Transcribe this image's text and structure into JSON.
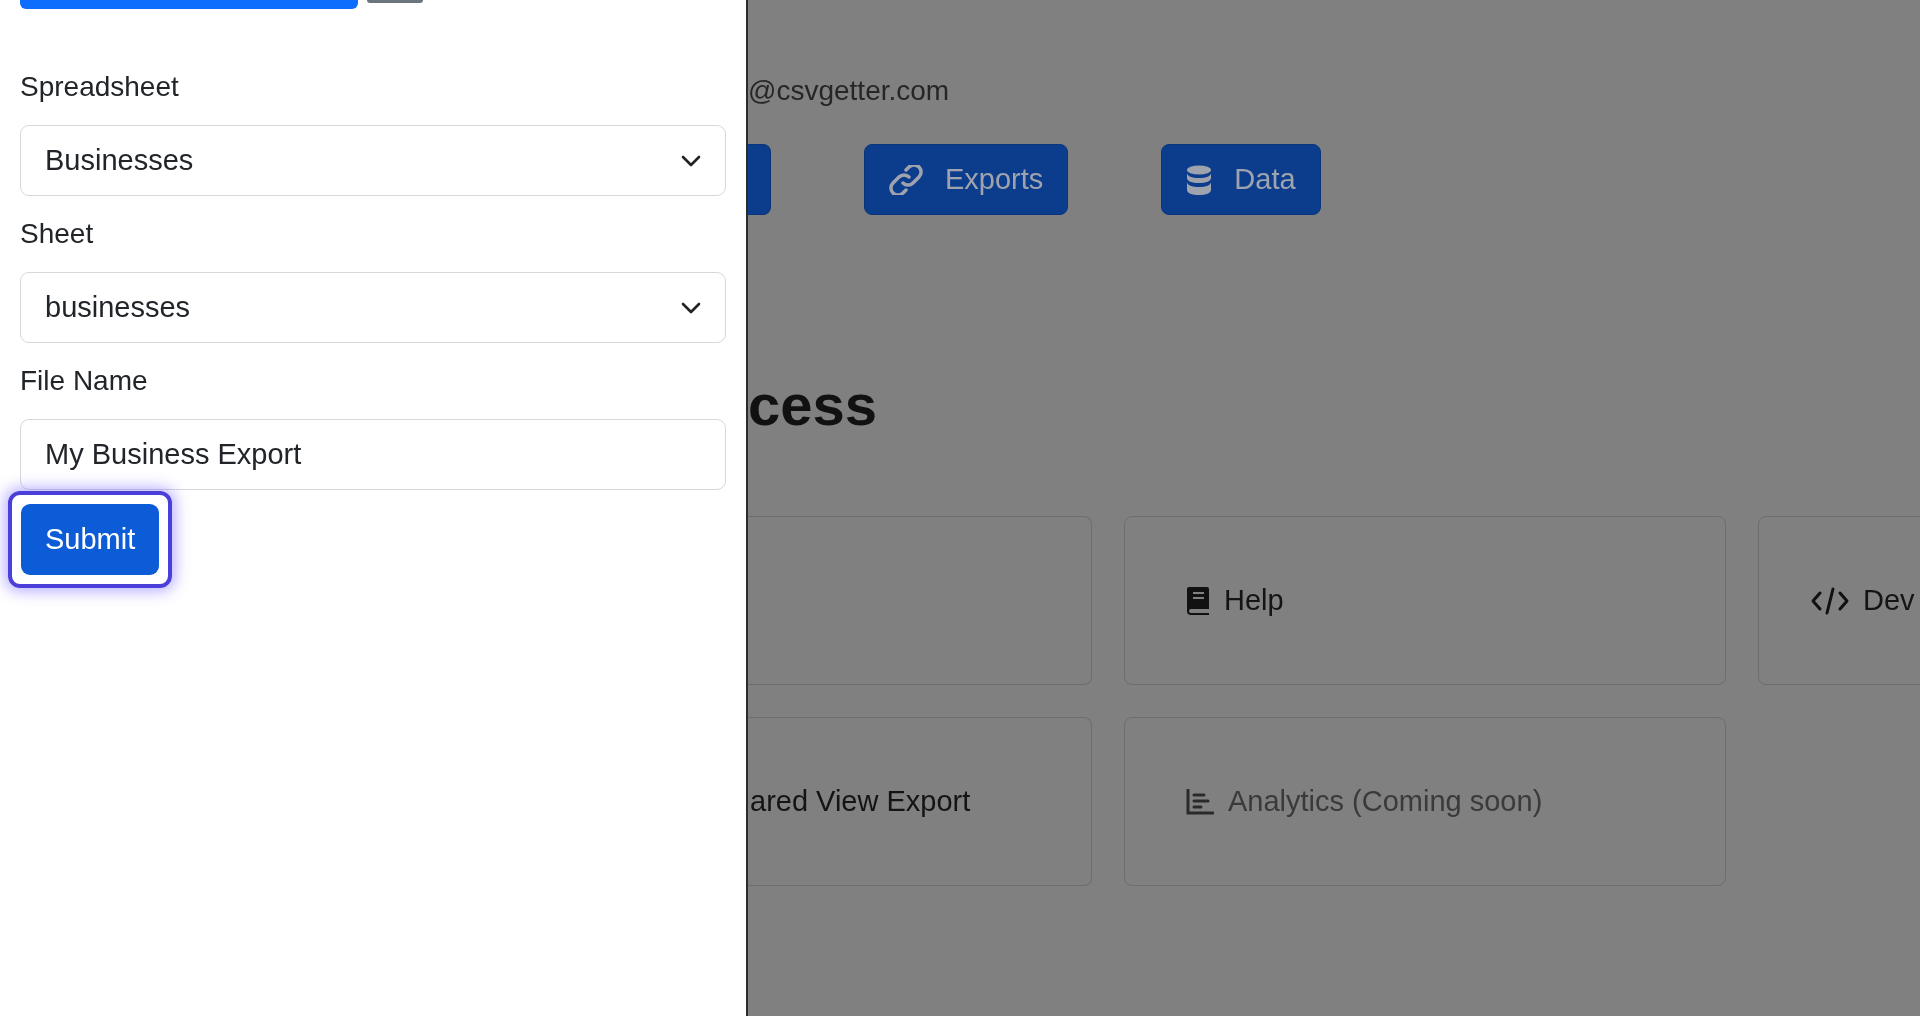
{
  "drawer": {
    "top_buttons": [
      {
        "kind": "primary"
      },
      {
        "kind": "secondary"
      }
    ],
    "fields": [
      {
        "kind": "select",
        "label": "Spreadsheet",
        "value": "Businesses"
      },
      {
        "kind": "select",
        "label": "Sheet",
        "value": "businesses"
      },
      {
        "kind": "text",
        "label": "File Name",
        "value": "My Business Export"
      }
    ],
    "submit": {
      "label": "Submit",
      "focused": true
    }
  },
  "page": {
    "email": "@csvgetter.com",
    "nav_buttons": [
      {
        "kind": "blank"
      },
      {
        "kind": "link",
        "label": "Exports"
      },
      {
        "kind": "database",
        "label": "Data"
      }
    ],
    "section_heading": "cess",
    "cards": [
      [
        {
          "kind": "blank"
        },
        {
          "kind": "book",
          "label": "Help",
          "disabled": false
        },
        {
          "kind": "code",
          "label": "Dev",
          "disabled": false
        }
      ],
      [
        {
          "kind": "none",
          "label": "ared View Export",
          "disabled": false
        },
        {
          "kind": "chart",
          "label": "Analytics (Coming soon)",
          "disabled": true
        }
      ]
    ]
  }
}
